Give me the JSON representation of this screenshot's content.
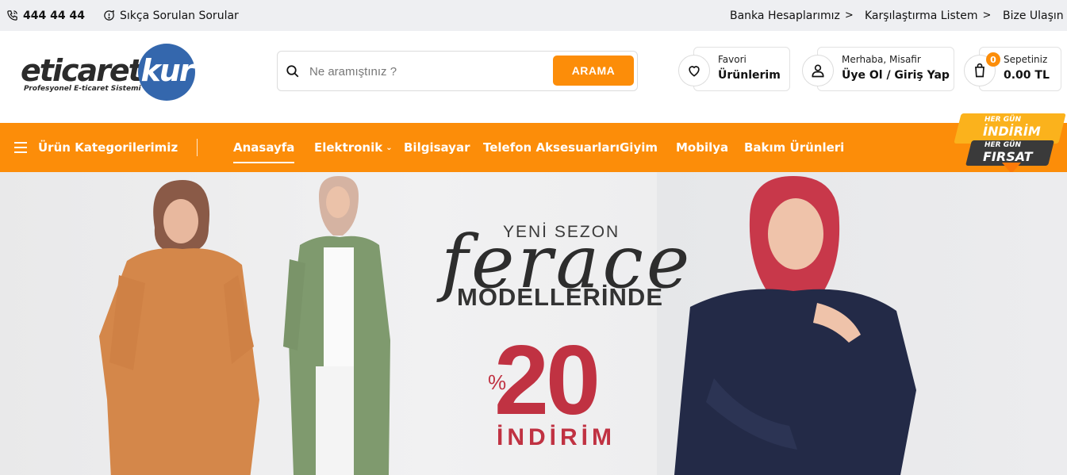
{
  "topbar": {
    "phone": "444 44 44",
    "faq": "Sıkça Sorulan Sorular",
    "bank_accounts": "Banka Hesaplarımız",
    "compare_list": "Karşılaştırma Listem",
    "contact": "Bize Ulaşın"
  },
  "header": {
    "logo_main": "eticaret",
    "logo_accent": "kur",
    "logo_tagline": "Profesyonel E-ticaret Sistemi",
    "search_placeholder": "Ne aramıştınız ?",
    "search_button": "ARAMA",
    "favorites_small": "Favori",
    "favorites_big": "Ürünlerim",
    "account_small": "Merhaba, Misafir",
    "account_big": "Üye Ol / Giriş Yap",
    "cart_count": "0",
    "cart_small": "Sepetiniz",
    "cart_total": "0.00 TL"
  },
  "nav": {
    "categories_label": "Ürün Kategorilerimiz",
    "links": [
      "Anasayfa",
      "Elektronik",
      "Bilgisayar",
      "Telefon Aksesuarları",
      "Giyim",
      "Mobilya",
      "Bakım Ürünleri"
    ],
    "active": "Anasayfa",
    "promo": {
      "line1": "HER GÜN",
      "line2": "İNDİRİM",
      "line3": "HER GÜN",
      "line4": "FIRSAT"
    }
  },
  "banner": {
    "season": "YENİ SEZON",
    "script": "ferace",
    "models": "MODELLERİNDE",
    "percent_sign": "%",
    "discount": "20",
    "discount_word": "İNDİRİM"
  },
  "colors": {
    "accent": "#fc8d09",
    "logo_blue": "#3467ad",
    "topbar_bg": "#eeeff2",
    "sale_red": "#c03242"
  }
}
